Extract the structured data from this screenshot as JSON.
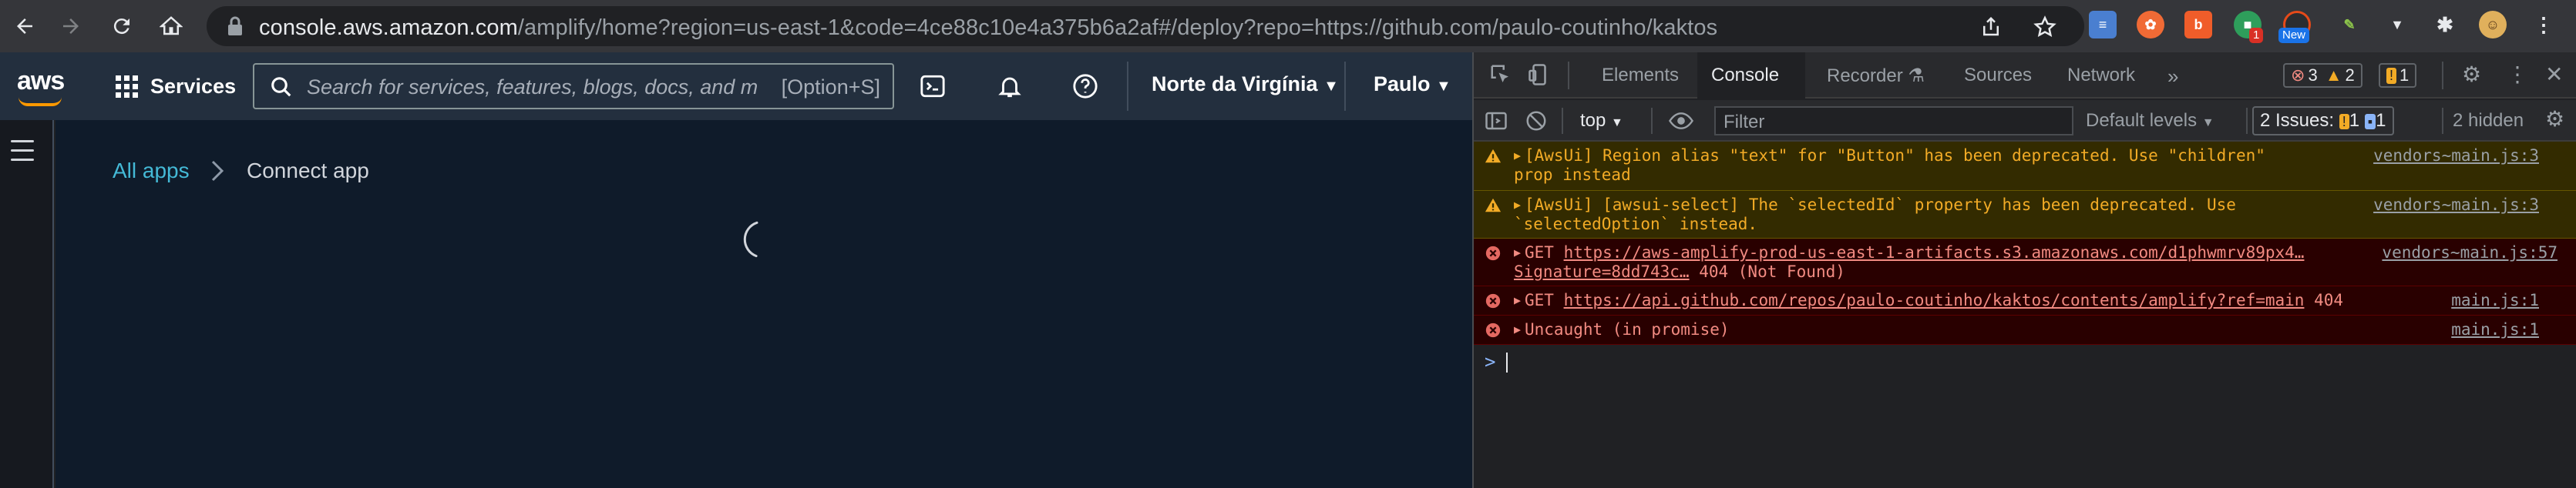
{
  "browser": {
    "url_host": "console.aws.amazon.com",
    "url_path": "/amplify/home?region=us-east-1&code=4ce88c10e4a375b6a2af#/deploy?repo=https://github.com/paulo-coutinho/kaktos",
    "extension_badges": [
      "1",
      "New"
    ]
  },
  "aws": {
    "logo_text": "aws",
    "services_label": "Services",
    "search_placeholder": "Search for services, features, blogs, docs, and m",
    "search_shortcut": "[Option+S]",
    "region_label": "Norte da Virgínia",
    "user_label": "Paulo",
    "brand_color": "#ff9900",
    "breadcrumb": {
      "root": "All apps",
      "current": "Connect app"
    }
  },
  "devtools": {
    "tabs": [
      "Elements",
      "Console",
      "Recorder",
      "Sources",
      "Network"
    ],
    "active_tab": "Console",
    "counts": {
      "errors": "3",
      "warnings": "2",
      "issues": "1"
    },
    "toolbar": {
      "context": "top",
      "filter_placeholder": "Filter",
      "levels": "Default levels",
      "issues_label": "2 Issues:",
      "issues_warn": "1",
      "issues_info": "1",
      "hidden": "2 hidden"
    },
    "messages": [
      {
        "level": "warning",
        "line1": "[AwsUi]  Region alias \"text\" for \"Button\" has been deprecated. Use \"children\"",
        "line2": "prop instead",
        "source": "vendors~main.js:3"
      },
      {
        "level": "warning",
        "line1": "[AwsUi]  [awsui-select] The `selectedId` property has been deprecated. Use",
        "line2": "`selectedOption` instead.",
        "source": "vendors~main.js:3"
      },
      {
        "level": "error",
        "prefix": "GET ",
        "link": "https://aws-amplify-prod-us-east-1-artifacts.s3.amazonaws.com/d1phwmrv89px4…",
        "line2_link": "Signature=8dd743c…",
        "line2_text": " 404 (Not Found)",
        "source": "vendors~main.js:57"
      },
      {
        "level": "error",
        "prefix": "GET ",
        "link": "https://api.github.com/repos/paulo-coutinho/kaktos/contents/amplify?ref=main",
        "status": "404",
        "source": "main.js:1"
      },
      {
        "level": "error",
        "text": "Uncaught (in promise)",
        "source": "main.js:1"
      }
    ],
    "prompt": ">"
  }
}
